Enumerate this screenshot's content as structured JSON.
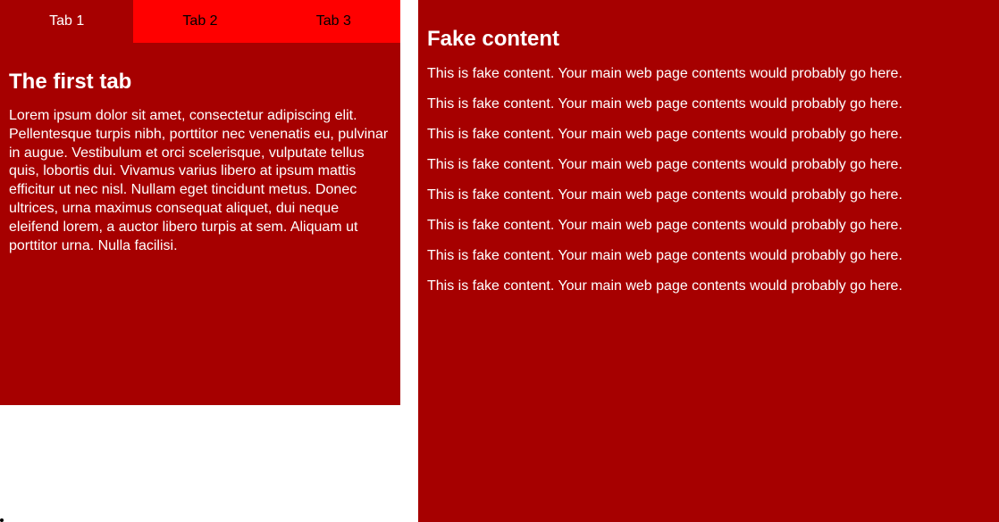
{
  "tabs": {
    "items": [
      {
        "label": "Tab 1",
        "active": true
      },
      {
        "label": "Tab 2",
        "active": false
      },
      {
        "label": "Tab 3",
        "active": false
      }
    ]
  },
  "tab_content": {
    "heading": "The first tab",
    "body": "Lorem ipsum dolor sit amet, consectetur adipiscing elit. Pellentesque turpis nibh, porttitor nec venenatis eu, pulvinar in augue. Vestibulum et orci scelerisque, vulputate tellus quis, lobortis dui. Vivamus varius libero at ipsum mattis efficitur ut nec nisl. Nullam eget tincidunt metus. Donec ultrices, urna maximus consequat aliquet, dui neque eleifend lorem, a auctor libero turpis at sem. Aliquam ut porttitor urna. Nulla facilisi."
  },
  "main_content": {
    "heading": "Fake content",
    "paragraphs": [
      "This is fake content. Your main web page contents would probably go here.",
      "This is fake content. Your main web page contents would probably go here.",
      "This is fake content. Your main web page contents would probably go here.",
      "This is fake content. Your main web page contents would probably go here.",
      "This is fake content. Your main web page contents would probably go here.",
      "This is fake content. Your main web page contents would probably go here.",
      "This is fake content. Your main web page contents would probably go here.",
      "This is fake content. Your main web page contents would probably go here."
    ]
  },
  "colors": {
    "active_bg": "#a60000",
    "inactive_bg": "#ff0000",
    "text_light": "#ffffff",
    "text_dark": "#000000"
  }
}
